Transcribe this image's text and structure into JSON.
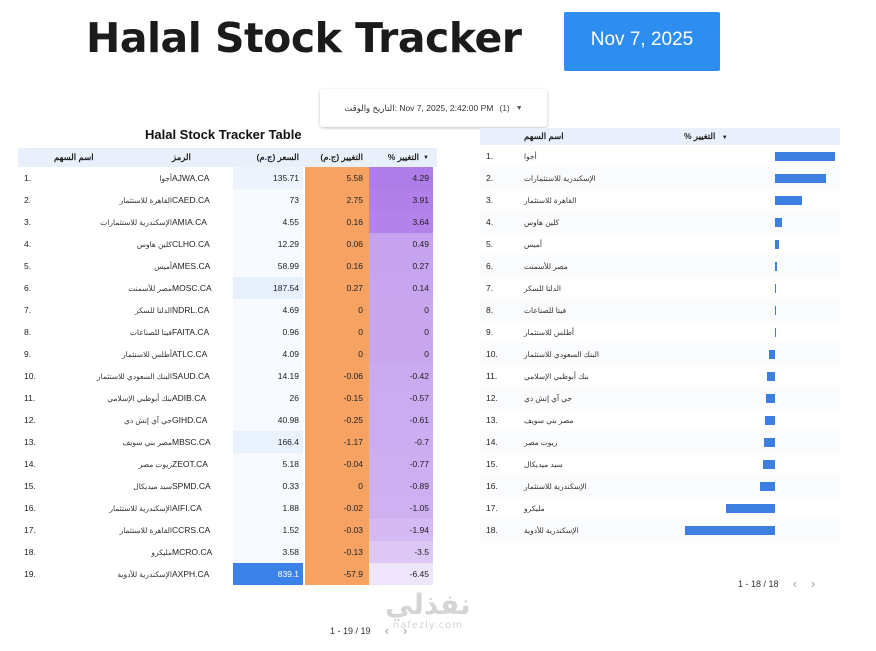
{
  "header": {
    "title": "Halal Stock Tracker",
    "date_label": "Nov 7, 2025",
    "date_caption": "",
    "filter_label": "التاريخ والوقت: Nov 7, 2025, 2:42:00 PM",
    "filter_count": "(1)"
  },
  "left_table": {
    "title": "Halal Stock Tracker Table",
    "headers": {
      "name": "اسم السهم",
      "symbol": "الرمز",
      "price": "السعر (ج.م)",
      "change": "التغيير (ج.م)",
      "pct": "% التغيير"
    },
    "rows": [
      {
        "idx": "1.",
        "name": "أجوا",
        "symbol": "AJWA.CA",
        "price": "135.71",
        "change": "5.58",
        "pct": "4.29"
      },
      {
        "idx": "2.",
        "name": "القاهرة للاستثمار",
        "symbol": "CAED.CA",
        "price": "73",
        "change": "2.75",
        "pct": "3.91"
      },
      {
        "idx": "3.",
        "name": "الإسكندرية للاستثمارات",
        "symbol": "AMIA.CA",
        "price": "4.55",
        "change": "0.16",
        "pct": "3.64"
      },
      {
        "idx": "4.",
        "name": "كلين هاوس",
        "symbol": "CLHO.CA",
        "price": "12.29",
        "change": "0.06",
        "pct": "0.49"
      },
      {
        "idx": "5.",
        "name": "أميس",
        "symbol": "AMES.CA",
        "price": "58.99",
        "change": "0.16",
        "pct": "0.27"
      },
      {
        "idx": "6.",
        "name": "مصر للأسمنت",
        "symbol": "MOSC.CA",
        "price": "187.54",
        "change": "0.27",
        "pct": "0.14"
      },
      {
        "idx": "7.",
        "name": "الدلتا للسكر",
        "symbol": "NDRL.CA",
        "price": "4.69",
        "change": "0",
        "pct": "0"
      },
      {
        "idx": "8.",
        "name": "فيتا للصناعات",
        "symbol": "FAITA.CA",
        "price": "0.96",
        "change": "0",
        "pct": "0"
      },
      {
        "idx": "9.",
        "name": "أطلس للاستثمار",
        "symbol": "ATLC.CA",
        "price": "4.09",
        "change": "0",
        "pct": "0"
      },
      {
        "idx": "10.",
        "name": "البنك السعودي للاستثمار",
        "symbol": "SAUD.CA",
        "price": "14.19",
        "change": "-0.06",
        "pct": "-0.42"
      },
      {
        "idx": "11.",
        "name": "بنك أبوظبي الإسلامي",
        "symbol": "ADIB.CA",
        "price": "26",
        "change": "-0.15",
        "pct": "-0.57"
      },
      {
        "idx": "12.",
        "name": "جي آي إتش دي",
        "symbol": "GIHD.CA",
        "price": "40.98",
        "change": "-0.25",
        "pct": "-0.61"
      },
      {
        "idx": "13.",
        "name": "مصر بني سويف",
        "symbol": "MBSC.CA",
        "price": "166.4",
        "change": "-1.17",
        "pct": "-0.7"
      },
      {
        "idx": "14.",
        "name": "زيوت مصر",
        "symbol": "ZEOT.CA",
        "price": "5.18",
        "change": "-0.04",
        "pct": "-0.77"
      },
      {
        "idx": "15.",
        "name": "سيد ميديكال",
        "symbol": "SPMD.CA",
        "price": "0.33",
        "change": "0",
        "pct": "-0.89"
      },
      {
        "idx": "16.",
        "name": "الإسكندرية للاستثمار",
        "symbol": "AIFI.CA",
        "price": "1.88",
        "change": "-0.02",
        "pct": "-1.05"
      },
      {
        "idx": "17.",
        "name": "القاهرة للاستثمار",
        "symbol": "CCRS.CA",
        "price": "1.52",
        "change": "-0.03",
        "pct": "-1.94"
      },
      {
        "idx": "18.",
        "name": "مليكرو",
        "symbol": "MCRO.CA",
        "price": "3.58",
        "change": "-0.13",
        "pct": "-3.5"
      },
      {
        "idx": "19.",
        "name": "الإسكندرية للأدوية",
        "symbol": "AXPH.CA",
        "price": "839.1",
        "change": "-57.9",
        "pct": "-6.45"
      }
    ],
    "pager": "1 - 19 / 19"
  },
  "right_table": {
    "headers": {
      "name": "اسم السهم",
      "pct": "% التغيير"
    },
    "rows": [
      {
        "idx": "1.",
        "name": "أجوا",
        "value": 4.29
      },
      {
        "idx": "2.",
        "name": "الإسكندرية للاستثمارات",
        "value": 3.64
      },
      {
        "idx": "3.",
        "name": "القاهرة للاستثمار",
        "value": 1.95
      },
      {
        "idx": "4.",
        "name": "كلين هاوس",
        "value": 0.49
      },
      {
        "idx": "5.",
        "name": "أميس",
        "value": 0.27
      },
      {
        "idx": "6.",
        "name": "مصر للأسمنت",
        "value": 0.14
      },
      {
        "idx": "7.",
        "name": "الدلتا للسكر",
        "value": 0.03
      },
      {
        "idx": "8.",
        "name": "فيتا للصناعات",
        "value": 0.02
      },
      {
        "idx": "9.",
        "name": "أطلس للاستثمار",
        "value": 0.02
      },
      {
        "idx": "10.",
        "name": "البنك السعودي للاستثمار",
        "value": -0.42
      },
      {
        "idx": "11.",
        "name": "بنك أبوظبي الإسلامي",
        "value": -0.57
      },
      {
        "idx": "12.",
        "name": "جي آي إتش دي",
        "value": -0.61
      },
      {
        "idx": "13.",
        "name": "مصر بني سويف",
        "value": -0.7
      },
      {
        "idx": "14.",
        "name": "زيوت مصر",
        "value": -0.77
      },
      {
        "idx": "15.",
        "name": "سيد ميديكال",
        "value": -0.89
      },
      {
        "idx": "16.",
        "name": "الإسكندرية للاستثمار",
        "value": -1.05
      },
      {
        "idx": "17.",
        "name": "مليكرو",
        "value": -3.5
      },
      {
        "idx": "18.",
        "name": "الإسكندرية للأدوية",
        "value": -6.45
      }
    ],
    "pager": "1 - 18 / 18"
  },
  "watermark": {
    "big": "نفذلي",
    "small": "nafezly.com"
  },
  "colors": {
    "accent": "#2d8ef0",
    "header_bg": "#e9f0fb",
    "bar": "#3c7fe0",
    "change_col": "#f5a263",
    "pct_high": "#a57ce6",
    "pct_low": "#efe6fb",
    "price_high": "#3b82e8"
  }
}
